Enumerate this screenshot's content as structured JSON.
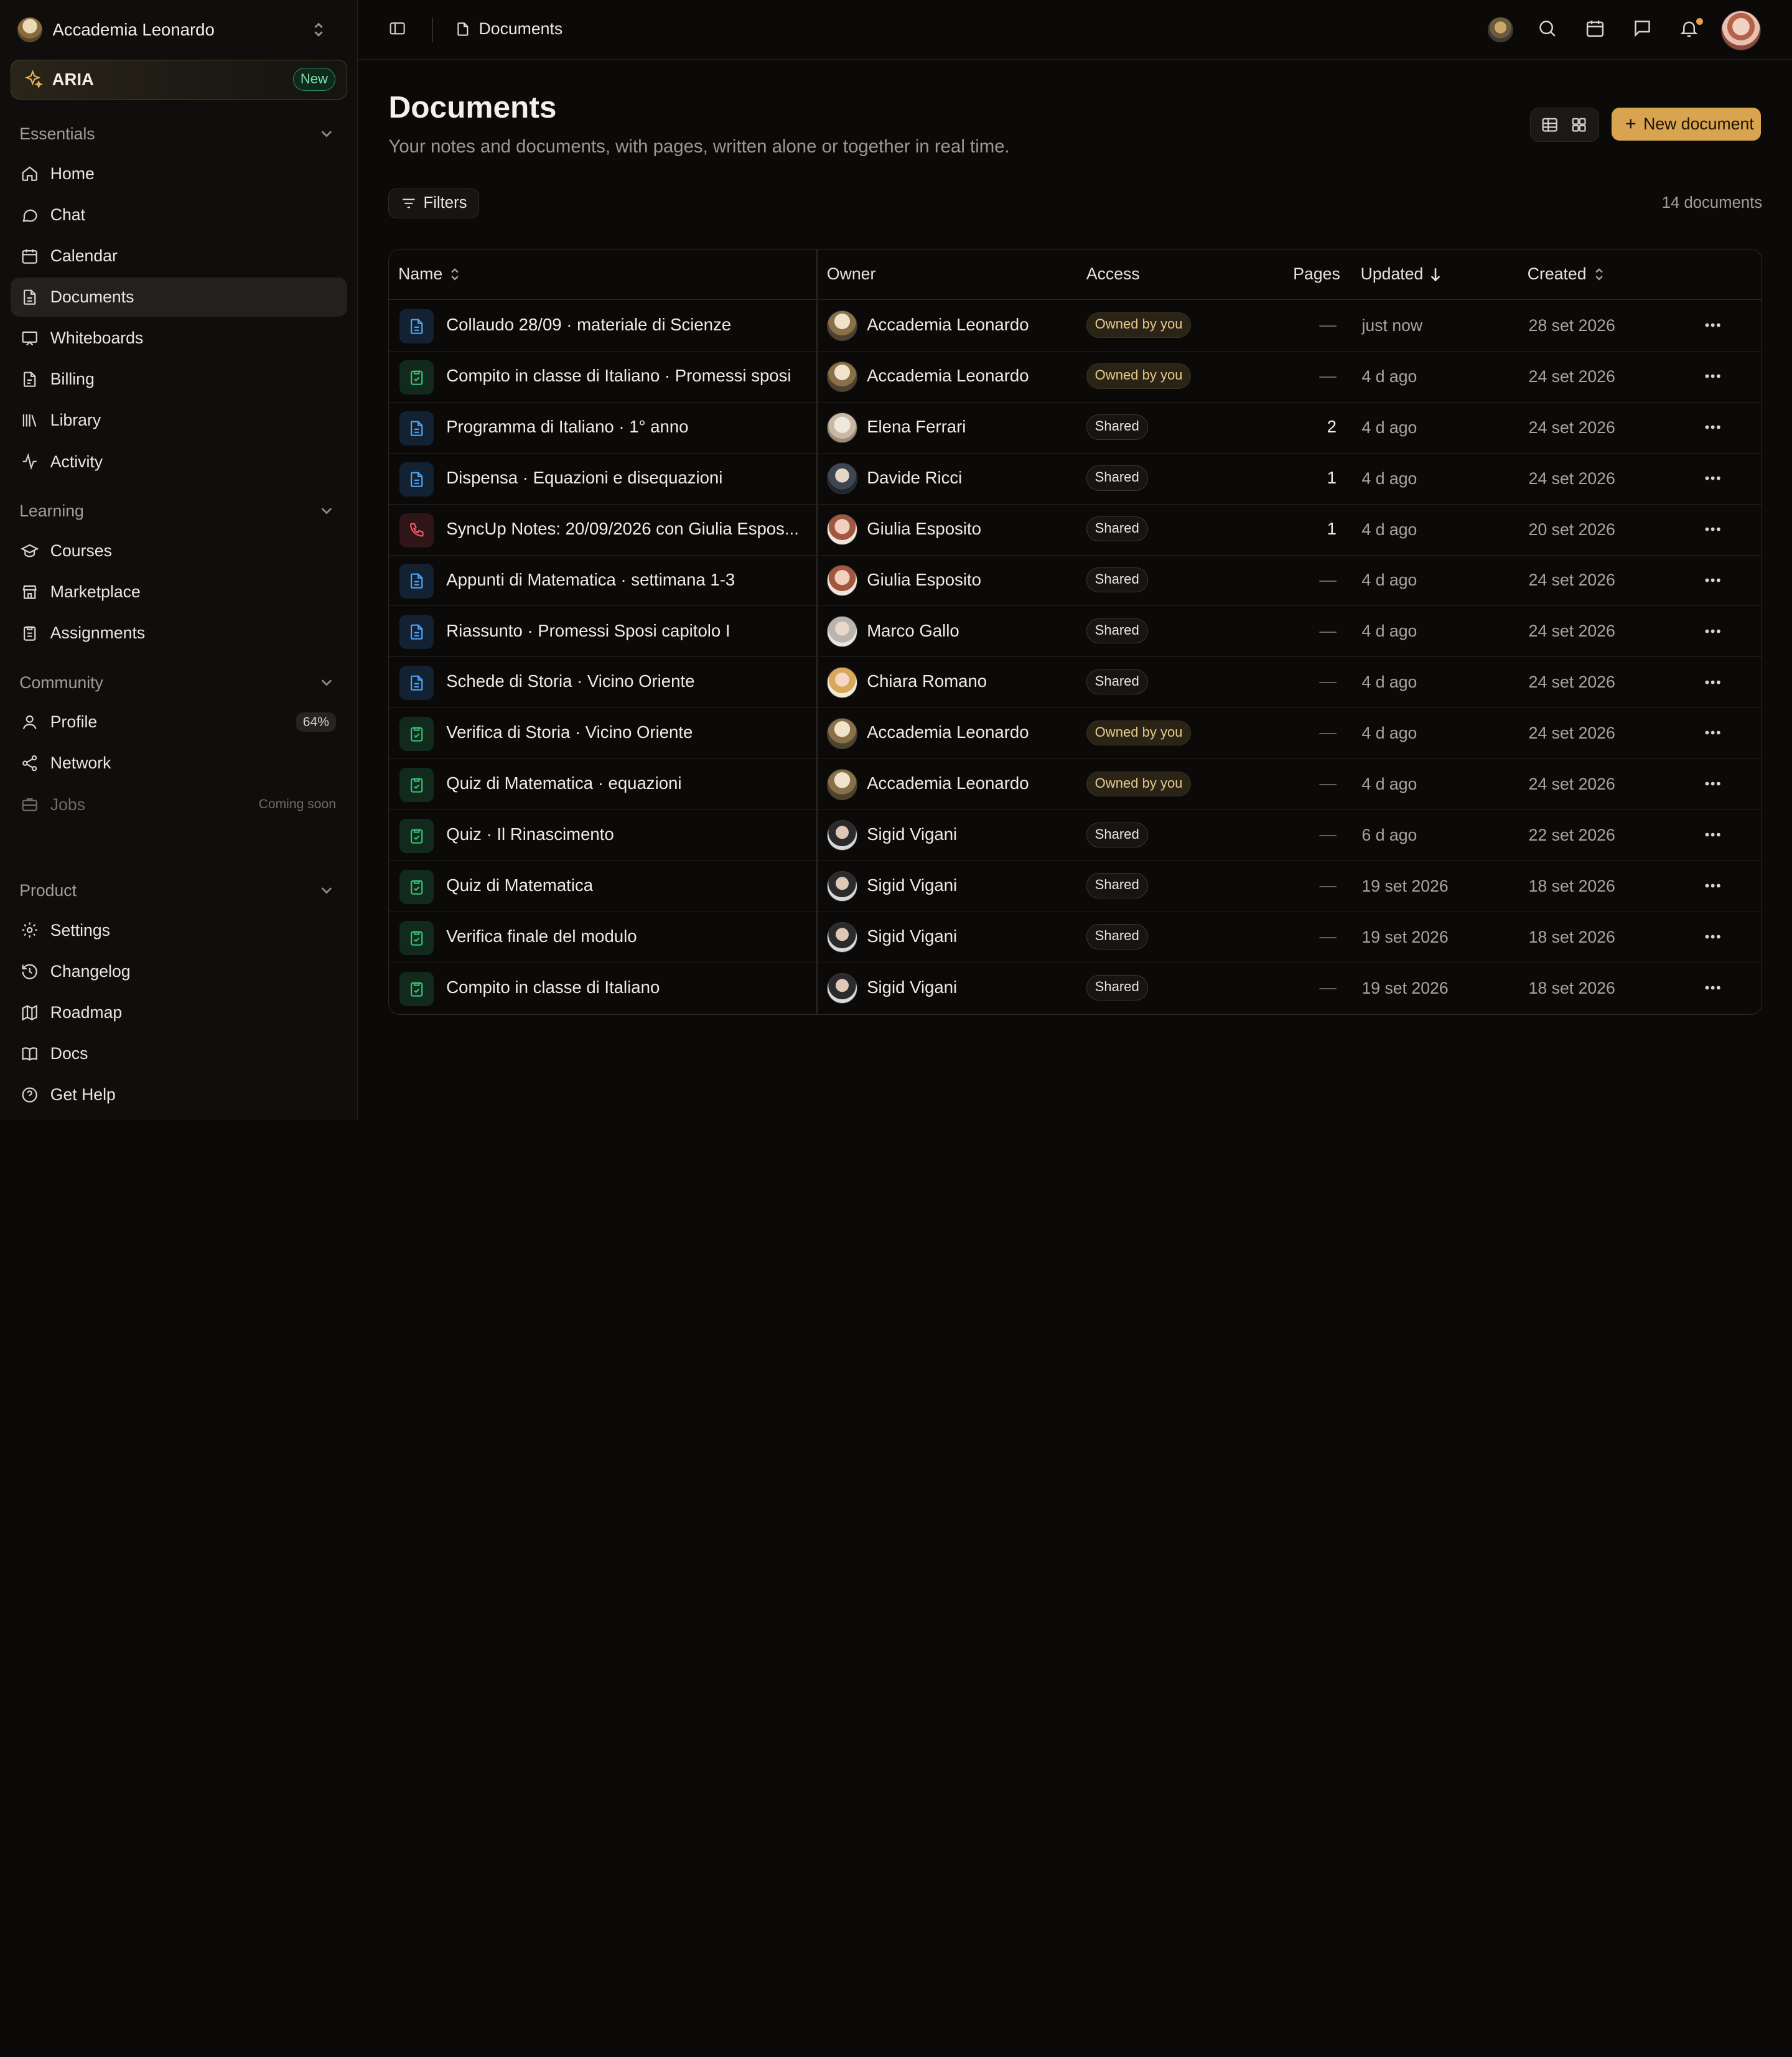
{
  "org": {
    "name": "Accademia Leonardo"
  },
  "aria": {
    "label": "ARIA",
    "badge": "New"
  },
  "sidebar": {
    "essentials": {
      "title": "Essentials",
      "items": [
        {
          "label": "Home"
        },
        {
          "label": "Chat"
        },
        {
          "label": "Calendar"
        },
        {
          "label": "Documents"
        },
        {
          "label": "Whiteboards"
        },
        {
          "label": "Billing"
        },
        {
          "label": "Library"
        },
        {
          "label": "Activity"
        }
      ]
    },
    "learning": {
      "title": "Learning",
      "items": [
        {
          "label": "Courses"
        },
        {
          "label": "Marketplace"
        },
        {
          "label": "Assignments"
        }
      ]
    },
    "community": {
      "title": "Community",
      "items": [
        {
          "label": "Profile",
          "badge": "64%"
        },
        {
          "label": "Network"
        },
        {
          "label": "Jobs",
          "badge": "Coming soon"
        }
      ]
    },
    "product": {
      "title": "Product",
      "items": [
        {
          "label": "Settings"
        },
        {
          "label": "Changelog"
        },
        {
          "label": "Roadmap"
        },
        {
          "label": "Docs"
        },
        {
          "label": "Get Help"
        }
      ]
    }
  },
  "topbar": {
    "breadcrumb": "Documents"
  },
  "page": {
    "title": "Documents",
    "subtitle": "Your notes and documents, with pages, written alone or together in real time.",
    "new_button": "New document",
    "filters": "Filters",
    "count": "14 documents"
  },
  "table": {
    "headers": {
      "name": "Name",
      "owner": "Owner",
      "access": "Access",
      "pages": "Pages",
      "updated": "Updated",
      "created": "Created"
    },
    "rows": [
      {
        "name": "Collaudo 28/09 · materiale di Scienze",
        "owner": "Accademia Leonardo",
        "access": "Owned by you",
        "pages": "—",
        "updated": "just now",
        "created": "28 set 2026"
      },
      {
        "name": "Compito in classe di Italiano · Promessi sposi",
        "owner": "Accademia Leonardo",
        "access": "Owned by you",
        "pages": "—",
        "updated": "4 d ago",
        "created": "24 set 2026"
      },
      {
        "name": "Programma di Italiano · 1° anno",
        "owner": "Elena Ferrari",
        "access": "Shared",
        "pages": "2",
        "updated": "4 d ago",
        "created": "24 set 2026"
      },
      {
        "name": "Dispensa · Equazioni e disequazioni",
        "owner": "Davide Ricci",
        "access": "Shared",
        "pages": "1",
        "updated": "4 d ago",
        "created": "24 set 2026"
      },
      {
        "name": "SyncUp Notes: 20/09/2026 con Giulia Espos...",
        "owner": "Giulia Esposito",
        "access": "Shared",
        "pages": "1",
        "updated": "4 d ago",
        "created": "20 set 2026"
      },
      {
        "name": "Appunti di Matematica · settimana 1-3",
        "owner": "Giulia Esposito",
        "access": "Shared",
        "pages": "—",
        "updated": "4 d ago",
        "created": "24 set 2026"
      },
      {
        "name": "Riassunto · Promessi Sposi capitolo I",
        "owner": "Marco Gallo",
        "access": "Shared",
        "pages": "—",
        "updated": "4 d ago",
        "created": "24 set 2026"
      },
      {
        "name": "Schede di Storia · Vicino Oriente",
        "owner": "Chiara Romano",
        "access": "Shared",
        "pages": "—",
        "updated": "4 d ago",
        "created": "24 set 2026"
      },
      {
        "name": "Verifica di Storia · Vicino Oriente",
        "owner": "Accademia Leonardo",
        "access": "Owned by you",
        "pages": "—",
        "updated": "4 d ago",
        "created": "24 set 2026"
      },
      {
        "name": "Quiz di Matematica · equazioni",
        "owner": "Accademia Leonardo",
        "access": "Owned by you",
        "pages": "—",
        "updated": "4 d ago",
        "created": "24 set 2026"
      },
      {
        "name": "Quiz · Il Rinascimento",
        "owner": "Sigid Vigani",
        "access": "Shared",
        "pages": "—",
        "updated": "6 d ago",
        "created": "22 set 2026"
      },
      {
        "name": "Quiz di Matematica",
        "owner": "Sigid Vigani",
        "access": "Shared",
        "pages": "—",
        "updated": "19 set 2026",
        "created": "18 set 2026"
      },
      {
        "name": "Verifica finale del modulo",
        "owner": "Sigid Vigani",
        "access": "Shared",
        "pages": "—",
        "updated": "19 set 2026",
        "created": "18 set 2026"
      },
      {
        "name": "Compito in classe di Italiano",
        "owner": "Sigid Vigani",
        "access": "Shared",
        "pages": "—",
        "updated": "19 set 2026",
        "created": "18 set 2026"
      }
    ]
  }
}
